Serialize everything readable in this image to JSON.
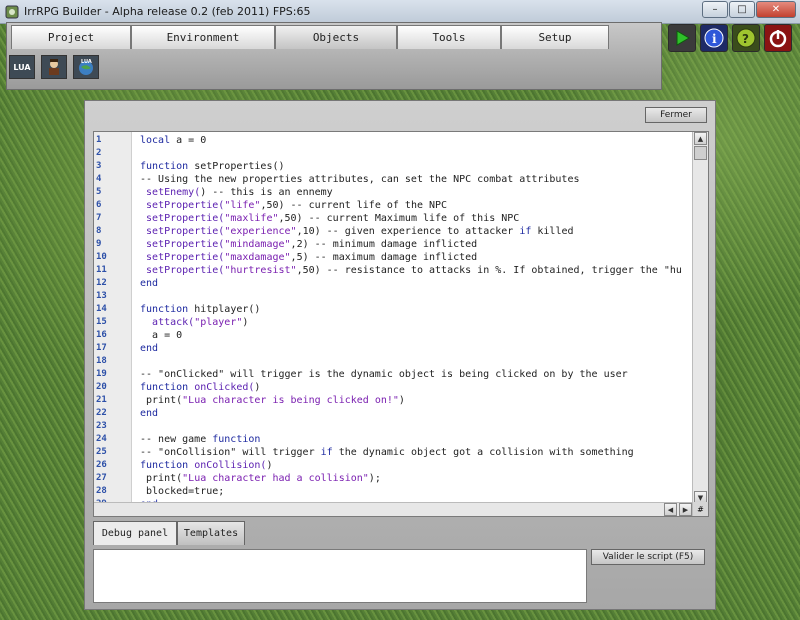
{
  "window": {
    "title": "IrrRPG Builder - Alpha release 0.2 (feb 2011) FPS:65",
    "minimize": "–",
    "maximize": "□",
    "close": "✕"
  },
  "menu": {
    "tabs": [
      {
        "label": "Project"
      },
      {
        "label": "Environment"
      },
      {
        "label": "Objects"
      },
      {
        "label": "Tools"
      },
      {
        "label": "Setup"
      }
    ],
    "active_tab": "Objects",
    "tools": [
      {
        "label": "LUA",
        "icon": "lua-script-icon"
      },
      {
        "label": "",
        "icon": "character-icon"
      },
      {
        "label": "",
        "icon": "lua-globe-icon"
      }
    ]
  },
  "right_buttons": [
    {
      "icon": "play-icon"
    },
    {
      "icon": "info-icon"
    },
    {
      "icon": "help-icon"
    },
    {
      "icon": "power-icon"
    }
  ],
  "editor": {
    "close_label": "Fermer",
    "lines": [
      "local a = 0",
      "",
      "function setProperties()",
      "-- Using the new properties attributes, can set the NPC combat attributes",
      " setEnemy() -- this is an ennemy",
      " setPropertie(\"life\",50) -- current life of the NPC",
      " setPropertie(\"maxlife\",50) -- current Maximum life of this NPC",
      " setPropertie(\"experience\",10) -- given experience to attacker if killed",
      " setPropertie(\"mindamage\",2) -- minimum damage inflicted",
      " setPropertie(\"maxdamage\",5) -- maximum damage inflicted",
      " setPropertie(\"hurtresist\",50) -- resistance to attacks in %. If obtained, trigger the \"hu",
      "end",
      "",
      "function hitplayer()",
      "  attack(\"player\")",
      "  a = 0",
      "end",
      "",
      "-- \"onClicked\" will trigger is the dynamic object is being clicked on by the user",
      "function onClicked()",
      " print(\"Lua character is being clicked on!\")",
      "end",
      "",
      "-- new game function",
      "-- \"onCollision\" will trigger if the dynamic object got a collision with something",
      "function onCollision()",
      " print(\"Lua character had a collision\");",
      " blocked=true;",
      "end"
    ]
  },
  "bottom": {
    "tabs": [
      {
        "label": "Debug panel"
      },
      {
        "label": "Templates"
      }
    ],
    "active_tab": "Debug panel",
    "validate_label": "Valider le script (F5)",
    "debug_text": ""
  },
  "colors": {
    "keyword": "#1e2aa0",
    "function_call": "#5a1fb0",
    "line_number": "#2d50a8"
  }
}
